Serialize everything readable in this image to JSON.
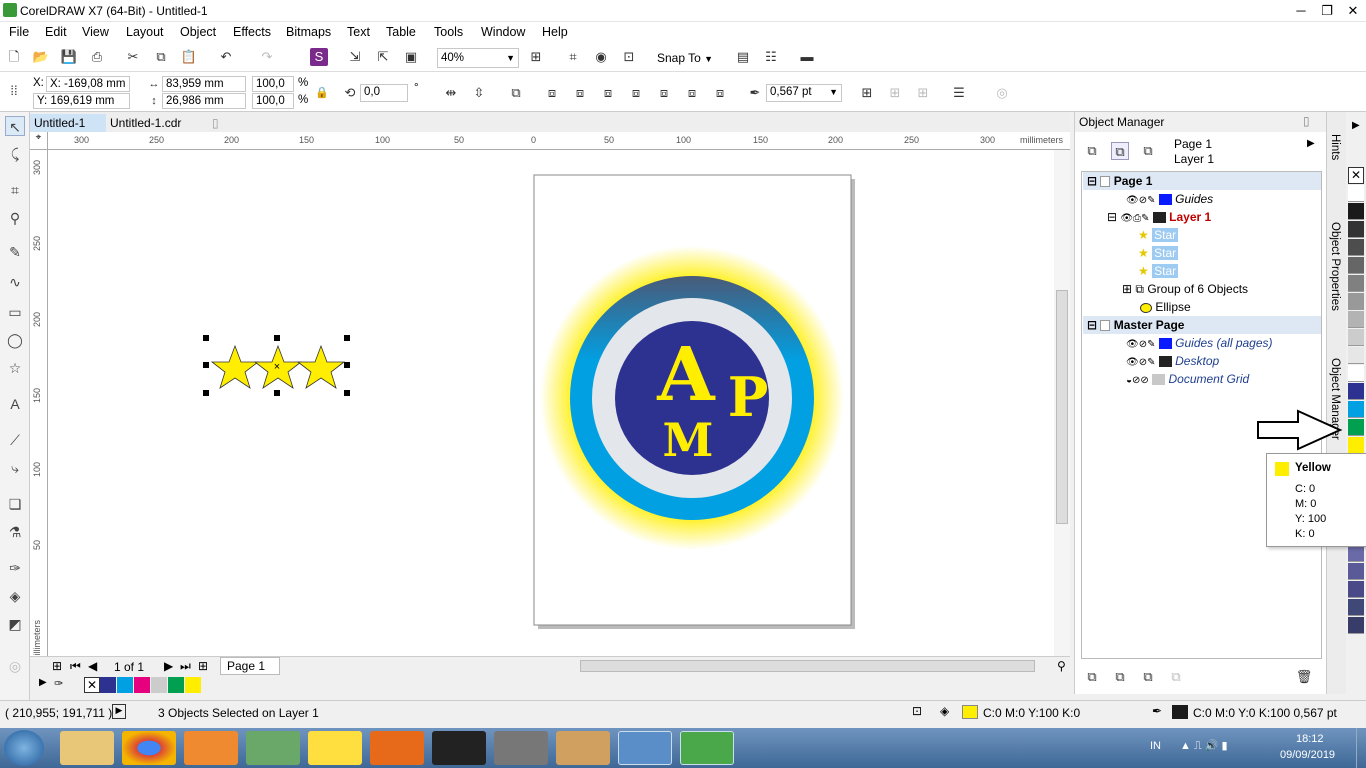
{
  "window": {
    "title": "CorelDRAW X7 (64-Bit) - Untitled-1"
  },
  "menu": [
    "File",
    "Edit",
    "View",
    "Layout",
    "Object",
    "Effects",
    "Bitmaps",
    "Text",
    "Table",
    "Tools",
    "Window",
    "Help"
  ],
  "toolbar": {
    "zoom": "40%",
    "snap_to": "Snap To"
  },
  "property_bar": {
    "x": "X: -169,08 mm",
    "y": "Y: 169,619 mm",
    "width": "83,959 mm",
    "height": "26,986 mm",
    "scale_x": "100,0",
    "scale_y": "100,0",
    "pct": "%",
    "angle": "0,0",
    "deg": "°",
    "outline_width": "0,567 pt"
  },
  "doc_tabs": [
    "Untitled-1",
    "Untitled-1.cdr"
  ],
  "ruler": {
    "h_labels": [
      "300",
      "250",
      "200",
      "150",
      "100",
      "50",
      "0",
      "50",
      "100",
      "150",
      "200",
      "250",
      "300"
    ],
    "unit": "millimeters",
    "v_labels": [
      "300",
      "250",
      "200",
      "150",
      "100",
      "50"
    ]
  },
  "logo": {
    "letters": [
      "A",
      "P",
      "M"
    ]
  },
  "page_nav": {
    "count": "1 of 1",
    "page_tab": "Page 1"
  },
  "object_manager": {
    "title": "Object Manager",
    "current_page": "Page 1",
    "current_layer": "Layer 1",
    "rows": [
      {
        "label": "Page 1",
        "type": "section"
      },
      {
        "label": "Guides",
        "color": "#0a1aff",
        "italic": true
      },
      {
        "label": "Layer 1",
        "color": "#222222",
        "active": true
      },
      {
        "label": "Star",
        "selected": true
      },
      {
        "label": "Star",
        "selected": true
      },
      {
        "label": "Star",
        "selected": true
      },
      {
        "label": "Group of 6 Objects"
      },
      {
        "label": "Ellipse"
      },
      {
        "label": "Master Page",
        "type": "section"
      },
      {
        "label": "Guides (all pages)",
        "color": "#0a1aff",
        "italic": true
      },
      {
        "label": "Desktop",
        "color": "#222222",
        "italic": true
      },
      {
        "label": "Document Grid",
        "color": "#c8c8c8",
        "italic": true
      }
    ]
  },
  "docker_tabs": [
    "Hints",
    "Object Properties",
    "Object Manager"
  ],
  "tooltip": {
    "name": "Yellow",
    "c": "C: 0",
    "m": "M: 0",
    "y": "Y: 100",
    "k": "K: 0"
  },
  "status": {
    "coords": "( 210,955; 191,711 )",
    "selection": "3 Objects Selected on Layer 1",
    "fill": "C:0 M:0 Y:100 K:0",
    "outline": "C:0 M:0 Y:0 K:100  0,567 pt"
  },
  "taskbar": {
    "lang": "IN",
    "time": "18:12",
    "date": "09/09/2019"
  },
  "colors": {
    "yellow": "#ffee00",
    "navy": "#2d3190",
    "cyan": "#00a0e3",
    "accent": "#cce4f7"
  },
  "palette_swatches": [
    "#2d3190",
    "#00a0e3",
    "#e6007e",
    "#cccccc",
    "#00a050",
    "#ffee00"
  ],
  "right_palette": [
    "#ffffff",
    "#1a1a1a",
    "#333333",
    "#4d4d4d",
    "#666666",
    "#808080",
    "#999999",
    "#b3b3b3",
    "#cccccc",
    "#e6e6e6",
    "#ffffff",
    "#2d3190",
    "#00a0e3",
    "#00a050",
    "#ffee00",
    "#e6192d",
    "#f5a0a0",
    "#c0c0e0",
    "#9fa0d0",
    "#8080b8",
    "#6a6aa8",
    "#5a5a98",
    "#4a4a88",
    "#404878",
    "#383c68"
  ]
}
